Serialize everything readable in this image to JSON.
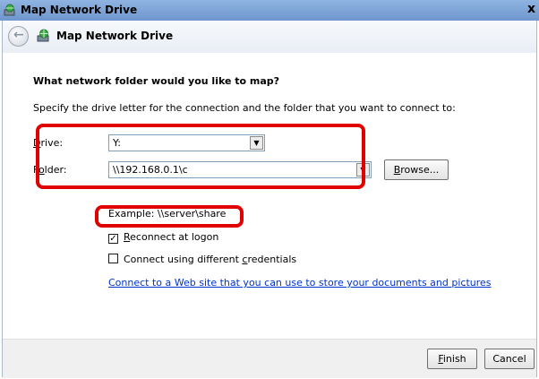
{
  "titlebar": {
    "title": "Map Network Drive",
    "close_label": "x"
  },
  "header": {
    "title": "Map Network Drive",
    "back_icon": "back-arrow-icon"
  },
  "main": {
    "heading": "What network folder would you like to map?",
    "description": "Specify the drive letter for the connection and the folder that you want to connect to:",
    "drive": {
      "label_ul": "D",
      "label_rest": "rive:",
      "value": "Y:"
    },
    "folder": {
      "label_pre": "F",
      "label_ul": "o",
      "label_rest": "lder:",
      "value": "\\\\192.168.0.1\\c"
    },
    "browse": {
      "label_ul": "B",
      "label_rest": "rowse..."
    },
    "example": "Example: \\\\server\\share",
    "reconnect": {
      "checked": true,
      "label_ul": "R",
      "label_rest": "econnect at logon"
    },
    "credentials": {
      "checked": false,
      "label_pre": "Connect using different ",
      "label_ul": "c",
      "label_rest": "redentials"
    },
    "link": "Connect to a Web site that you can use to store your documents and pictures",
    "link_suffix": "."
  },
  "footer": {
    "finish": {
      "label_ul": "F",
      "label_rest": "inish"
    },
    "cancel": "Cancel"
  },
  "colors": {
    "highlight": "#e00000",
    "link": "#0033cc"
  }
}
